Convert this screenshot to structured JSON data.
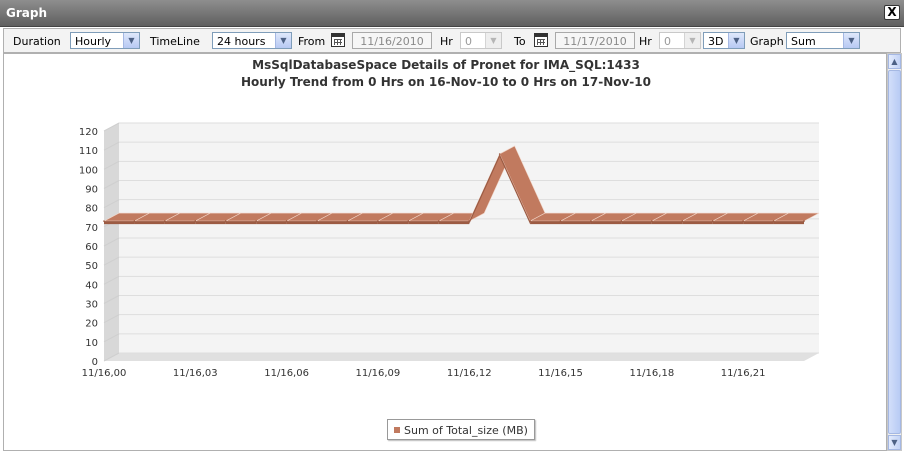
{
  "window": {
    "title": "Graph",
    "close_label": "X"
  },
  "toolbar": {
    "duration_label": "Duration",
    "duration_value": "Hourly",
    "timeline_label": "TimeLine",
    "timeline_value": "24 hours",
    "from_label": "From",
    "from_date": "11/16/2010",
    "from_hr_label": "Hr",
    "from_hr_value": "0",
    "to_label": "To",
    "to_date": "11/17/2010",
    "to_hr_label": "Hr",
    "to_hr_value": "0",
    "view_value": "3D",
    "graph_label": "Graph",
    "graph_value": "Sum"
  },
  "chart_data": {
    "type": "area",
    "title": "MsSqlDatabaseSpace Details of Pronet for IMA_SQL:1433",
    "subtitle": "Hourly Trend from 0 Hrs on 16-Nov-10 to 0 Hrs on 17-Nov-10",
    "three_d": true,
    "grid": true,
    "ylim": [
      0,
      120
    ],
    "yticks": [
      "0",
      "10",
      "20",
      "30",
      "40",
      "50",
      "60",
      "70",
      "80",
      "90",
      "100",
      "110",
      "120"
    ],
    "xtick_labels": [
      "11/16,00",
      "11/16,03",
      "11/16,06",
      "11/16,09",
      "11/16,12",
      "11/16,15",
      "11/16,18",
      "11/16,21"
    ],
    "x": [
      0,
      1,
      2,
      3,
      4,
      5,
      6,
      7,
      8,
      9,
      10,
      11,
      12,
      13,
      14,
      15,
      16,
      17,
      18,
      19,
      20,
      21,
      22,
      23
    ],
    "series": [
      {
        "name": "Sum of Total_size (MB)",
        "values": [
          73,
          73,
          73,
          73,
          73,
          73,
          73,
          73,
          73,
          73,
          73,
          73,
          73,
          108,
          73,
          73,
          73,
          73,
          73,
          73,
          73,
          73,
          73,
          73
        ]
      }
    ],
    "legend_position": "bottom",
    "series_color": "#c17a5f"
  }
}
